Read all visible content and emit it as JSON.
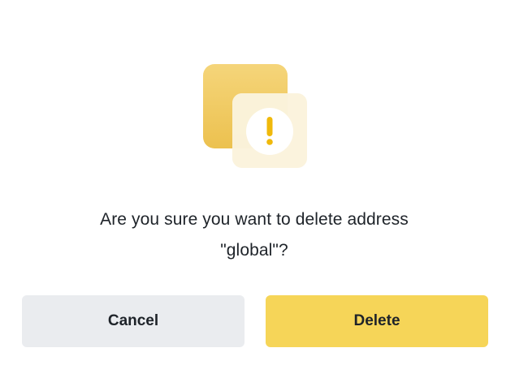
{
  "dialog": {
    "message_line1": "Are you sure you want to delete address",
    "message_line2": "\"global\"?",
    "cancel_label": "Cancel",
    "delete_label": "Delete",
    "icon": "warning-exclamation-icon"
  },
  "colors": {
    "primary_button": "#f6d558",
    "secondary_button": "#eaecef",
    "text": "#1e2329",
    "illustration_back": "#f0c95a",
    "illustration_front": "#fbf3d9"
  }
}
